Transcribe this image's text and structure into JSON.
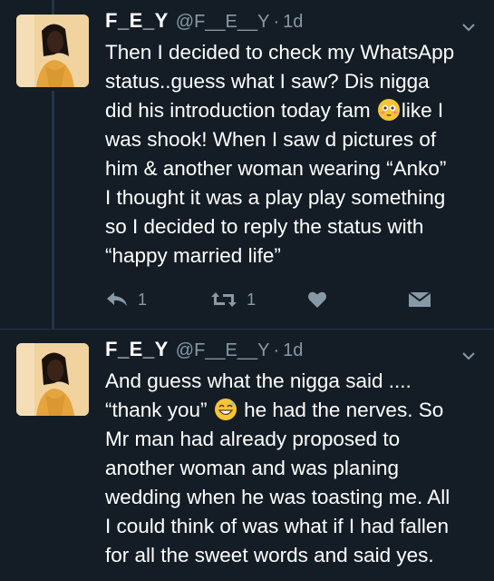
{
  "tweets": [
    {
      "name": "F_E_Y",
      "handle": "@F__E__Y",
      "separator": "·",
      "time": "1d",
      "lines": [
        {
          "text": "Then I decided to check my WhatsApp"
        },
        {
          "text": "status..guess what I saw? Dis nigga"
        },
        {
          "pre": "did his introduction today fam ",
          "emoji": "flushed-face-emoji",
          "post": "like I"
        },
        {
          "text": "was shook! When I saw d pictures of"
        },
        {
          "text": "him & another woman wearing “Anko”"
        },
        {
          "text": "I thought it was a play play something"
        },
        {
          "text": "so I decided to reply the status with"
        },
        {
          "text": "“happy married life”"
        }
      ],
      "reply_count": "1",
      "retweet_count": "1"
    },
    {
      "name": "F_E_Y",
      "handle": "@F__E__Y",
      "separator": "·",
      "time": "1d",
      "lines": [
        {
          "text": "And guess what the nigga said ...."
        },
        {
          "pre": "“thank you” ",
          "emoji": "grinning-sweat-emoji",
          "post": " he had the nerves. So"
        },
        {
          "text": "Mr man had already proposed to"
        },
        {
          "text": "another woman and was planing"
        },
        {
          "text": "wedding when he was toasting me. All"
        },
        {
          "text": "I could think of was what if I had fallen"
        },
        {
          "text": "for all the sweet words and said yes."
        }
      ]
    }
  ],
  "colors": {
    "background": "#141d26",
    "secondary_text": "#8899a6",
    "divider": "#243447",
    "emoji_yellow": "#f8c537"
  }
}
